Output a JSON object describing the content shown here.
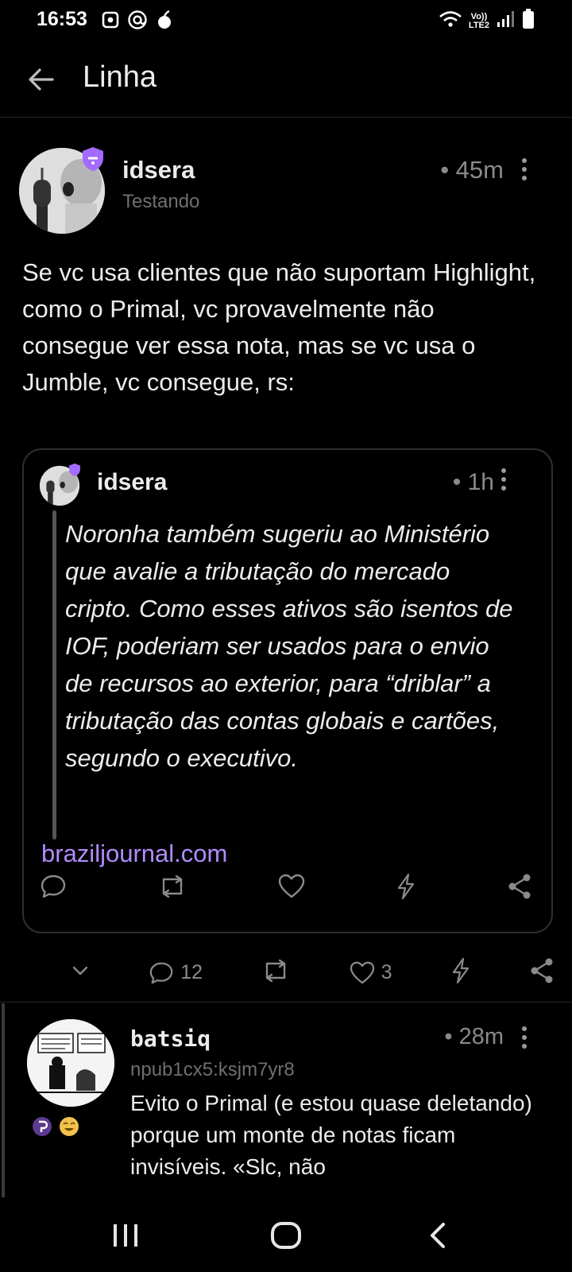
{
  "status_bar": {
    "time": "16:53",
    "network_label_1": "Vo))",
    "network_label_2": "LTE2"
  },
  "header": {
    "title": "Linha"
  },
  "note": {
    "author": "idsera",
    "subtitle": "Testando",
    "time": "• 45m",
    "text": "Se vc usa clientes que não suportam Highlight, como o Primal, vc provavelmente não consegue ver essa nota, mas se vc usa o Jumble, vc consegue, rs:",
    "quote": {
      "author": "idsera",
      "time": "• 1h",
      "highlight": "Noronha também sugeriu ao Ministério que avalie a tributação do mercado cripto. Como esses ativos são isentos de IOF, poderiam ser usados para o envio de recursos ao exterior, para “driblar” a tributação das contas globais e cartões, segundo o executivo.",
      "source": "braziljournal.com"
    },
    "actions": {
      "replies": "12",
      "likes": "3"
    }
  },
  "reply": {
    "author": "batsiq",
    "npub": "npub1cx5:ksjm7yr8",
    "time": "• 28m",
    "text": "Evito o Primal (e estou quase deletando) porque um monte de notas ficam invisíveis. «Slc, não"
  },
  "colors": {
    "background": "#000000",
    "accent": "#a36bff",
    "link": "#b18cff",
    "muted": "#8a8a8a"
  }
}
